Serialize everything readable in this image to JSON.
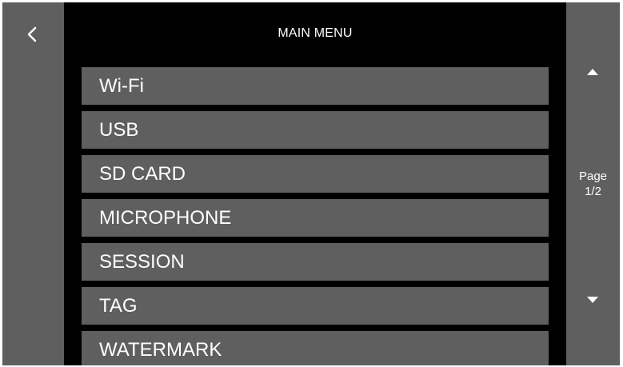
{
  "screen": {
    "title": "MAIN MENU",
    "back_icon": "chevron-left-icon"
  },
  "menu": {
    "items": [
      {
        "label": "Wi-Fi"
      },
      {
        "label": "USB"
      },
      {
        "label": "SD CARD"
      },
      {
        "label": "MICROPHONE"
      },
      {
        "label": "SESSION"
      },
      {
        "label": "TAG"
      },
      {
        "label": "WATERMARK"
      }
    ]
  },
  "pager": {
    "label": "Page",
    "value": "1/2",
    "up_icon": "triangle-up-icon",
    "down_icon": "triangle-down-icon"
  },
  "colors": {
    "panel": "#5f5f5f",
    "background": "#000000",
    "text": "#ffffff"
  }
}
